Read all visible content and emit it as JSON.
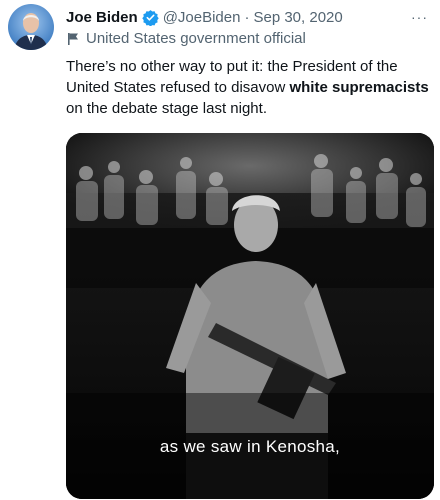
{
  "tweet": {
    "author_name": "Joe Biden",
    "handle": "@JoeBiden",
    "separator": "·",
    "date": "Sep 30, 2020",
    "more_label": "···",
    "label": "United States government official",
    "text_part1": "There’s no other way to put it: the President of the United States refused to disavow ",
    "text_bold": "white supremacists",
    "text_part2": " on the debate stage last night.",
    "icons": {
      "avatar": "profile-photo",
      "verified": "verified-badge-icon",
      "label": "flag-icon",
      "more": "more-options-icon"
    },
    "colors": {
      "verified": "#1d9bf0",
      "secondary_text": "#536471",
      "primary_text": "#0f1419"
    }
  },
  "media": {
    "type": "video",
    "caption": "as we saw in Kenosha,"
  }
}
